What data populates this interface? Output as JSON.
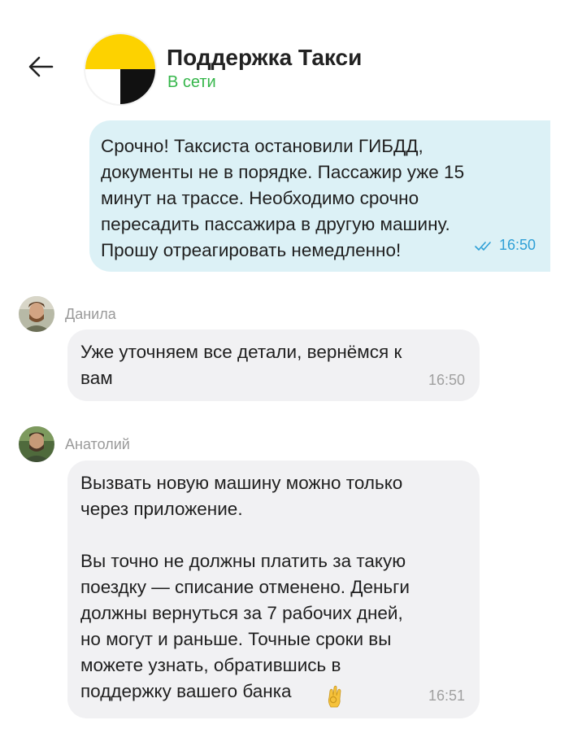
{
  "header": {
    "title": "Поддержка Такси",
    "status": "В сети",
    "back_icon": "arrow-left-icon",
    "logo_icon": "yandex-taxi-logo",
    "status_color": "#35b64a"
  },
  "messages": [
    {
      "direction": "outgoing",
      "text": "Срочно! Таксиста остановили ГИБДД,\nдокументы не в порядке. Пассажир уже 15\nминут на трассе. Необходимо срочно\nпересадить пассажира в другую машину.\nПрошу отреагировать немедленно!",
      "time": "16:50",
      "status_icon": "double-check-icon",
      "bubble_color": "#dcf1f6"
    },
    {
      "direction": "incoming",
      "sender": "Данила",
      "text": "Уже уточняем все детали, вернёмся к\nвам",
      "time": "16:50",
      "bubble_color": "#f1f1f3"
    },
    {
      "direction": "incoming",
      "sender": "Анатолий",
      "text": "Вызвать новую машину можно только\nчерез приложение.\n\nВы точно не должны платить за такую\nпоездку — списание отменено. Деньги\nдолжны вернуться за 7 рабочих дней,\nно могут и раньше. Точные сроки вы\nможете узнать, обратившись в\nподдержку вашего банка",
      "emoji_icon": "ok-hand-icon",
      "time": "16:51",
      "bubble_color": "#f1f1f3"
    }
  ]
}
